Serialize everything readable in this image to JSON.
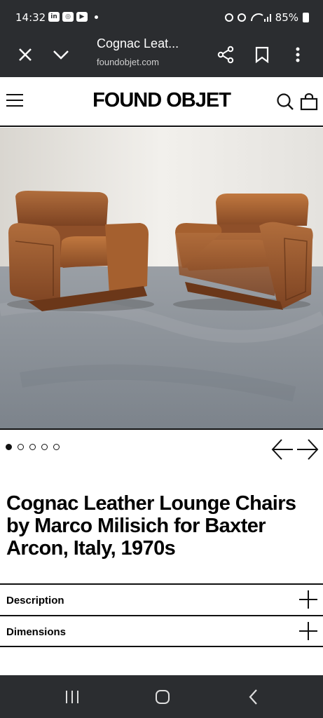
{
  "status": {
    "time": "14:32",
    "battery": "85%"
  },
  "browser": {
    "title": "Cognac Leat...",
    "url": "foundobjet.com"
  },
  "site": {
    "logo": "FOUND OBJET"
  },
  "carousel": {
    "total": 5,
    "current": 1
  },
  "product": {
    "title": "Cognac Leather Lounge Chairs by Marco Milisich for Baxter Arcon, Italy, 1970s"
  },
  "accordion": {
    "description": "Description",
    "dimensions": "Dimensions"
  },
  "colors": {
    "chrome": "#2b2d30",
    "leather": "#9a5a2e",
    "floor": "#8f959c",
    "wall": "#eceae6"
  }
}
